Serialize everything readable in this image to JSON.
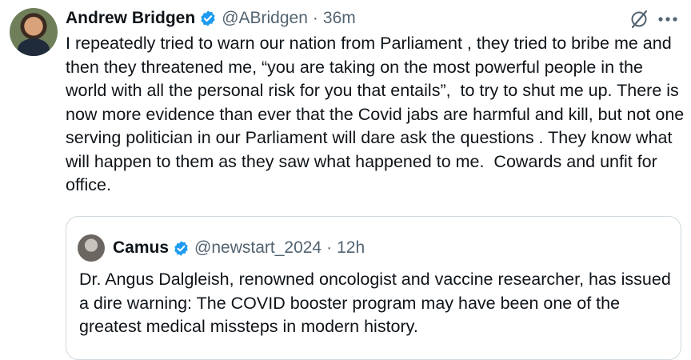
{
  "tweet": {
    "author_name": "Andrew Bridgen",
    "handle": "@ABridgen",
    "separator": "·",
    "time": "36m",
    "text": "I repeatedly tried to warn our nation from Parliament , they tried to bribe me and then they threatened me, “you are taking on the most powerful people in the world with all the personal risk for you that entails”,  to try to shut me up. There is now more evidence than ever that the Covid jabs are harmful and kill, but not one serving politician in our Parliament will dare ask the questions . They know what will happen to them as they saw what happened to me.  Cowards and unfit for office."
  },
  "quote": {
    "author_name": "Camus",
    "handle": "@newstart_2024",
    "separator": "·",
    "time": "12h",
    "text": "Dr. Angus Dalgleish, renowned oncologist and vaccine researcher, has issued a dire warning: The COVID booster program may have been one of the greatest medical missteps in modern history."
  },
  "icons": {
    "verified": "verified-badge-icon",
    "grok": "grok-icon",
    "more": "more-options-icon"
  },
  "colors": {
    "verified_blue": "#1d9bf0",
    "secondary_text": "#536471",
    "border": "#cfd9de"
  }
}
